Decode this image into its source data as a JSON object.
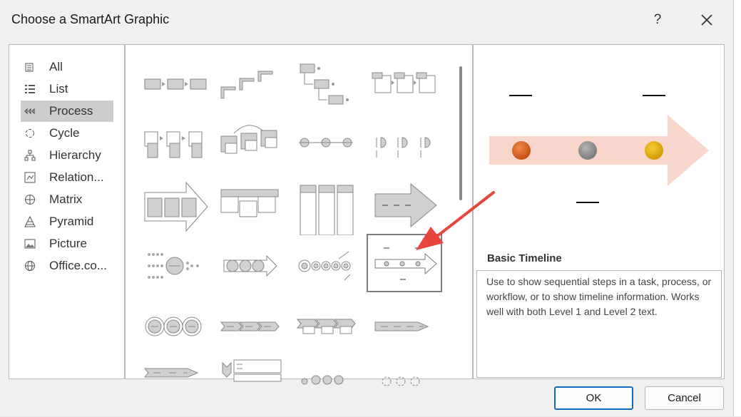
{
  "dialog": {
    "title": "Choose a SmartArt Graphic",
    "help_label": "?"
  },
  "categories": [
    {
      "label": "All",
      "icon": "all-icon"
    },
    {
      "label": "List",
      "icon": "list-icon"
    },
    {
      "label": "Process",
      "icon": "process-icon",
      "selected": true
    },
    {
      "label": "Cycle",
      "icon": "cycle-icon"
    },
    {
      "label": "Hierarchy",
      "icon": "hierarchy-icon"
    },
    {
      "label": "Relation...",
      "icon": "relationship-icon"
    },
    {
      "label": "Matrix",
      "icon": "matrix-icon"
    },
    {
      "label": "Pyramid",
      "icon": "pyramid-icon"
    },
    {
      "label": "Picture",
      "icon": "picture-icon"
    },
    {
      "label": "Office.co...",
      "icon": "globe-icon"
    }
  ],
  "gallery": {
    "selected_item": "Basic Timeline"
  },
  "preview": {
    "title": "Basic Timeline",
    "description": "Use to show sequential steps in a task, process, or workflow, or to show timeline information. Works well with both Level 1 and Level 2 text.",
    "dot_colors": [
      "#d9621c",
      "#8c8c8c",
      "#e8b000"
    ],
    "arrow_color": "#f8d6cc"
  },
  "buttons": {
    "ok_label": "OK",
    "cancel_label": "Cancel"
  },
  "annotation_color": "#e8453c"
}
